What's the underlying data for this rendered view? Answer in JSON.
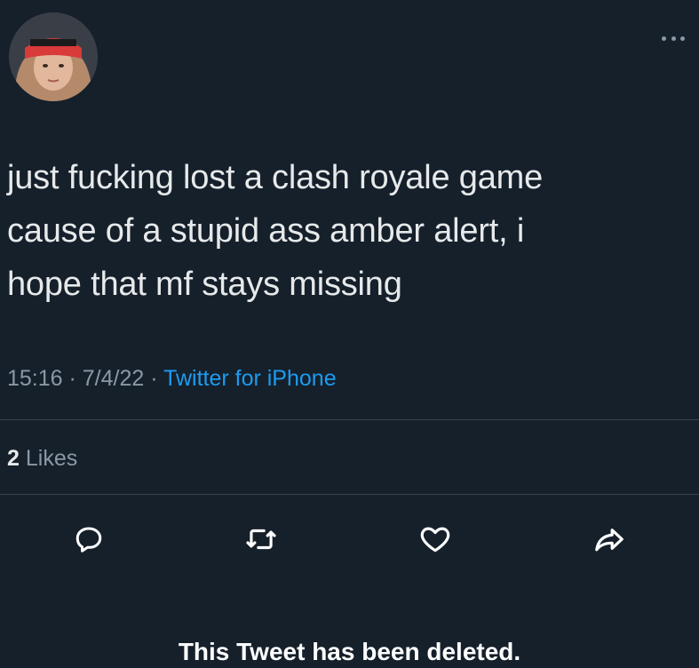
{
  "tweet": {
    "text_lines": [
      "just fucking lost a clash royale game",
      "cause of a stupid ass amber alert, i",
      "hope that mf stays missing"
    ],
    "time": "15:16",
    "date": "7/4/22",
    "separator": " · ",
    "source": "Twitter for iPhone",
    "likes_count": "2",
    "likes_label": "Likes"
  },
  "icons": {
    "more": "more-horizontal-icon",
    "reply": "reply-icon",
    "retweet": "retweet-icon",
    "like": "heart-icon",
    "share": "share-icon"
  },
  "colors": {
    "background": "#15202b",
    "text": "#e7e9ea",
    "muted": "#8b98a5",
    "link": "#1d9bf0",
    "divider": "#38444d"
  },
  "caption": "This Tweet has been deleted."
}
